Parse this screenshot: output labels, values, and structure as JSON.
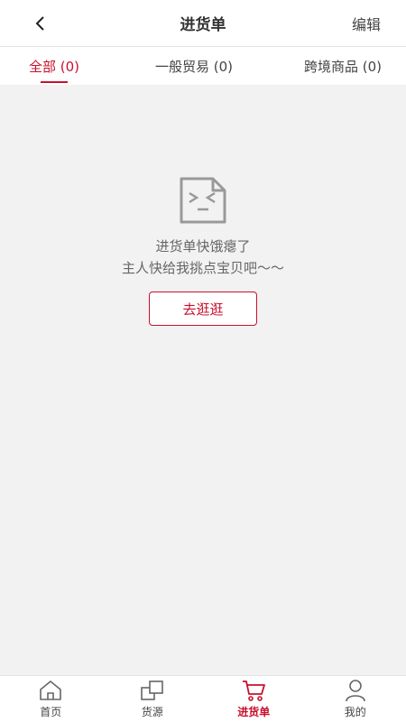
{
  "header": {
    "title": "进货单",
    "edit_label": "编辑"
  },
  "tabs": [
    {
      "label": "全部 (0)",
      "active": true
    },
    {
      "label": "一般贸易 (0)",
      "active": false
    },
    {
      "label": "跨境商品 (0)",
      "active": false
    }
  ],
  "empty_state": {
    "icon": "sad-document-icon",
    "line1": "进货单快饿瘪了",
    "line2": "主人快给我挑点宝贝吧～～",
    "button_label": "去逛逛"
  },
  "bottom_nav": [
    {
      "label": "首页",
      "icon": "home-icon",
      "active": false
    },
    {
      "label": "货源",
      "icon": "source-icon",
      "active": false
    },
    {
      "label": "进货单",
      "icon": "cart-icon",
      "active": true
    },
    {
      "label": "我的",
      "icon": "user-icon",
      "active": false
    }
  ],
  "colors": {
    "accent": "#c8102e",
    "background": "#f2f2f2",
    "icon_gray": "#999999"
  }
}
